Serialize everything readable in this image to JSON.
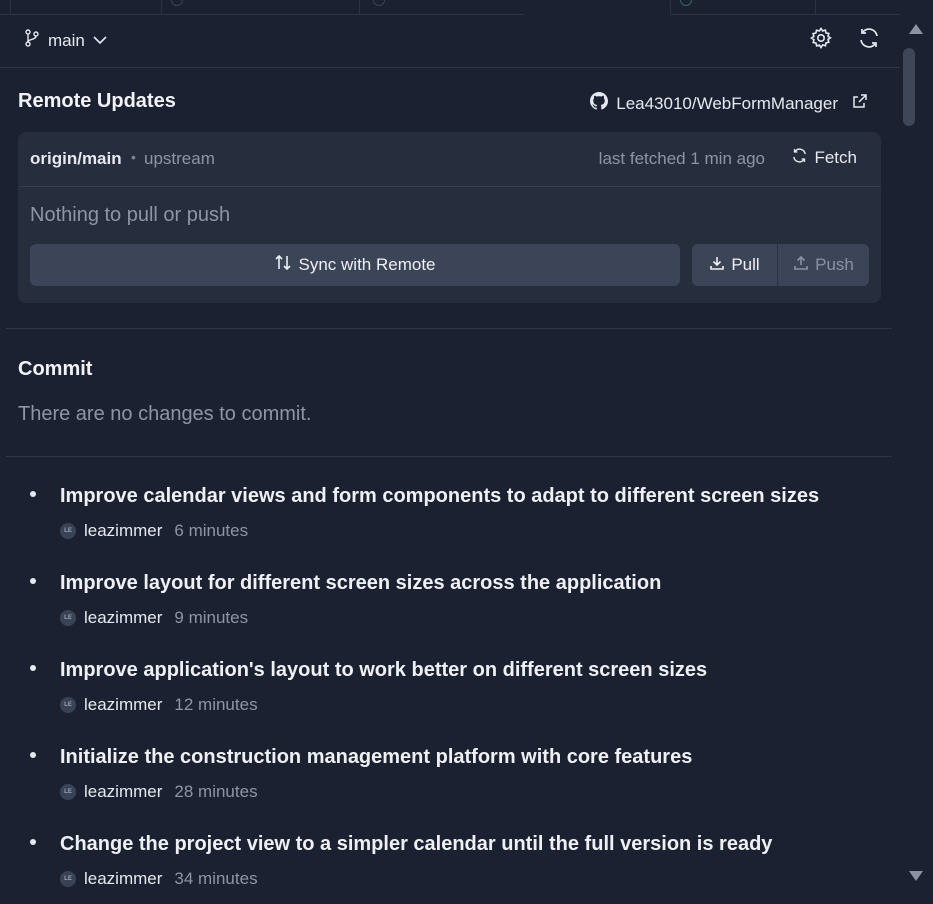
{
  "branch": {
    "name": "main"
  },
  "remote": {
    "title": "Remote Updates",
    "repo": "Lea43010/WebFormManager",
    "branch": "origin/main",
    "bullet": "•",
    "upstream": "upstream",
    "last_fetched": "last fetched 1 min ago",
    "fetch_label": "Fetch",
    "status": "Nothing to pull or push",
    "sync_label": "Sync with Remote",
    "pull_label": "Pull",
    "push_label": "Push"
  },
  "commit": {
    "title": "Commit",
    "empty": "There are no changes to commit."
  },
  "history": [
    {
      "message": "Improve calendar views and form components to adapt to different screen sizes",
      "avatar": "LE",
      "author": "leazimmer",
      "time": "6 minutes"
    },
    {
      "message": "Improve layout for different screen sizes across the application",
      "avatar": "LE",
      "author": "leazimmer",
      "time": "9 minutes"
    },
    {
      "message": "Improve application's layout to work better on different screen sizes",
      "avatar": "LE",
      "author": "leazimmer",
      "time": "12 minutes"
    },
    {
      "message": "Initialize the construction management platform with core features",
      "avatar": "LE",
      "author": "leazimmer",
      "time": "28 minutes"
    },
    {
      "message": "Change the project view to a simpler calendar until the full version is ready",
      "avatar": "LE",
      "author": "leazimmer",
      "time": "34 minutes"
    }
  ]
}
